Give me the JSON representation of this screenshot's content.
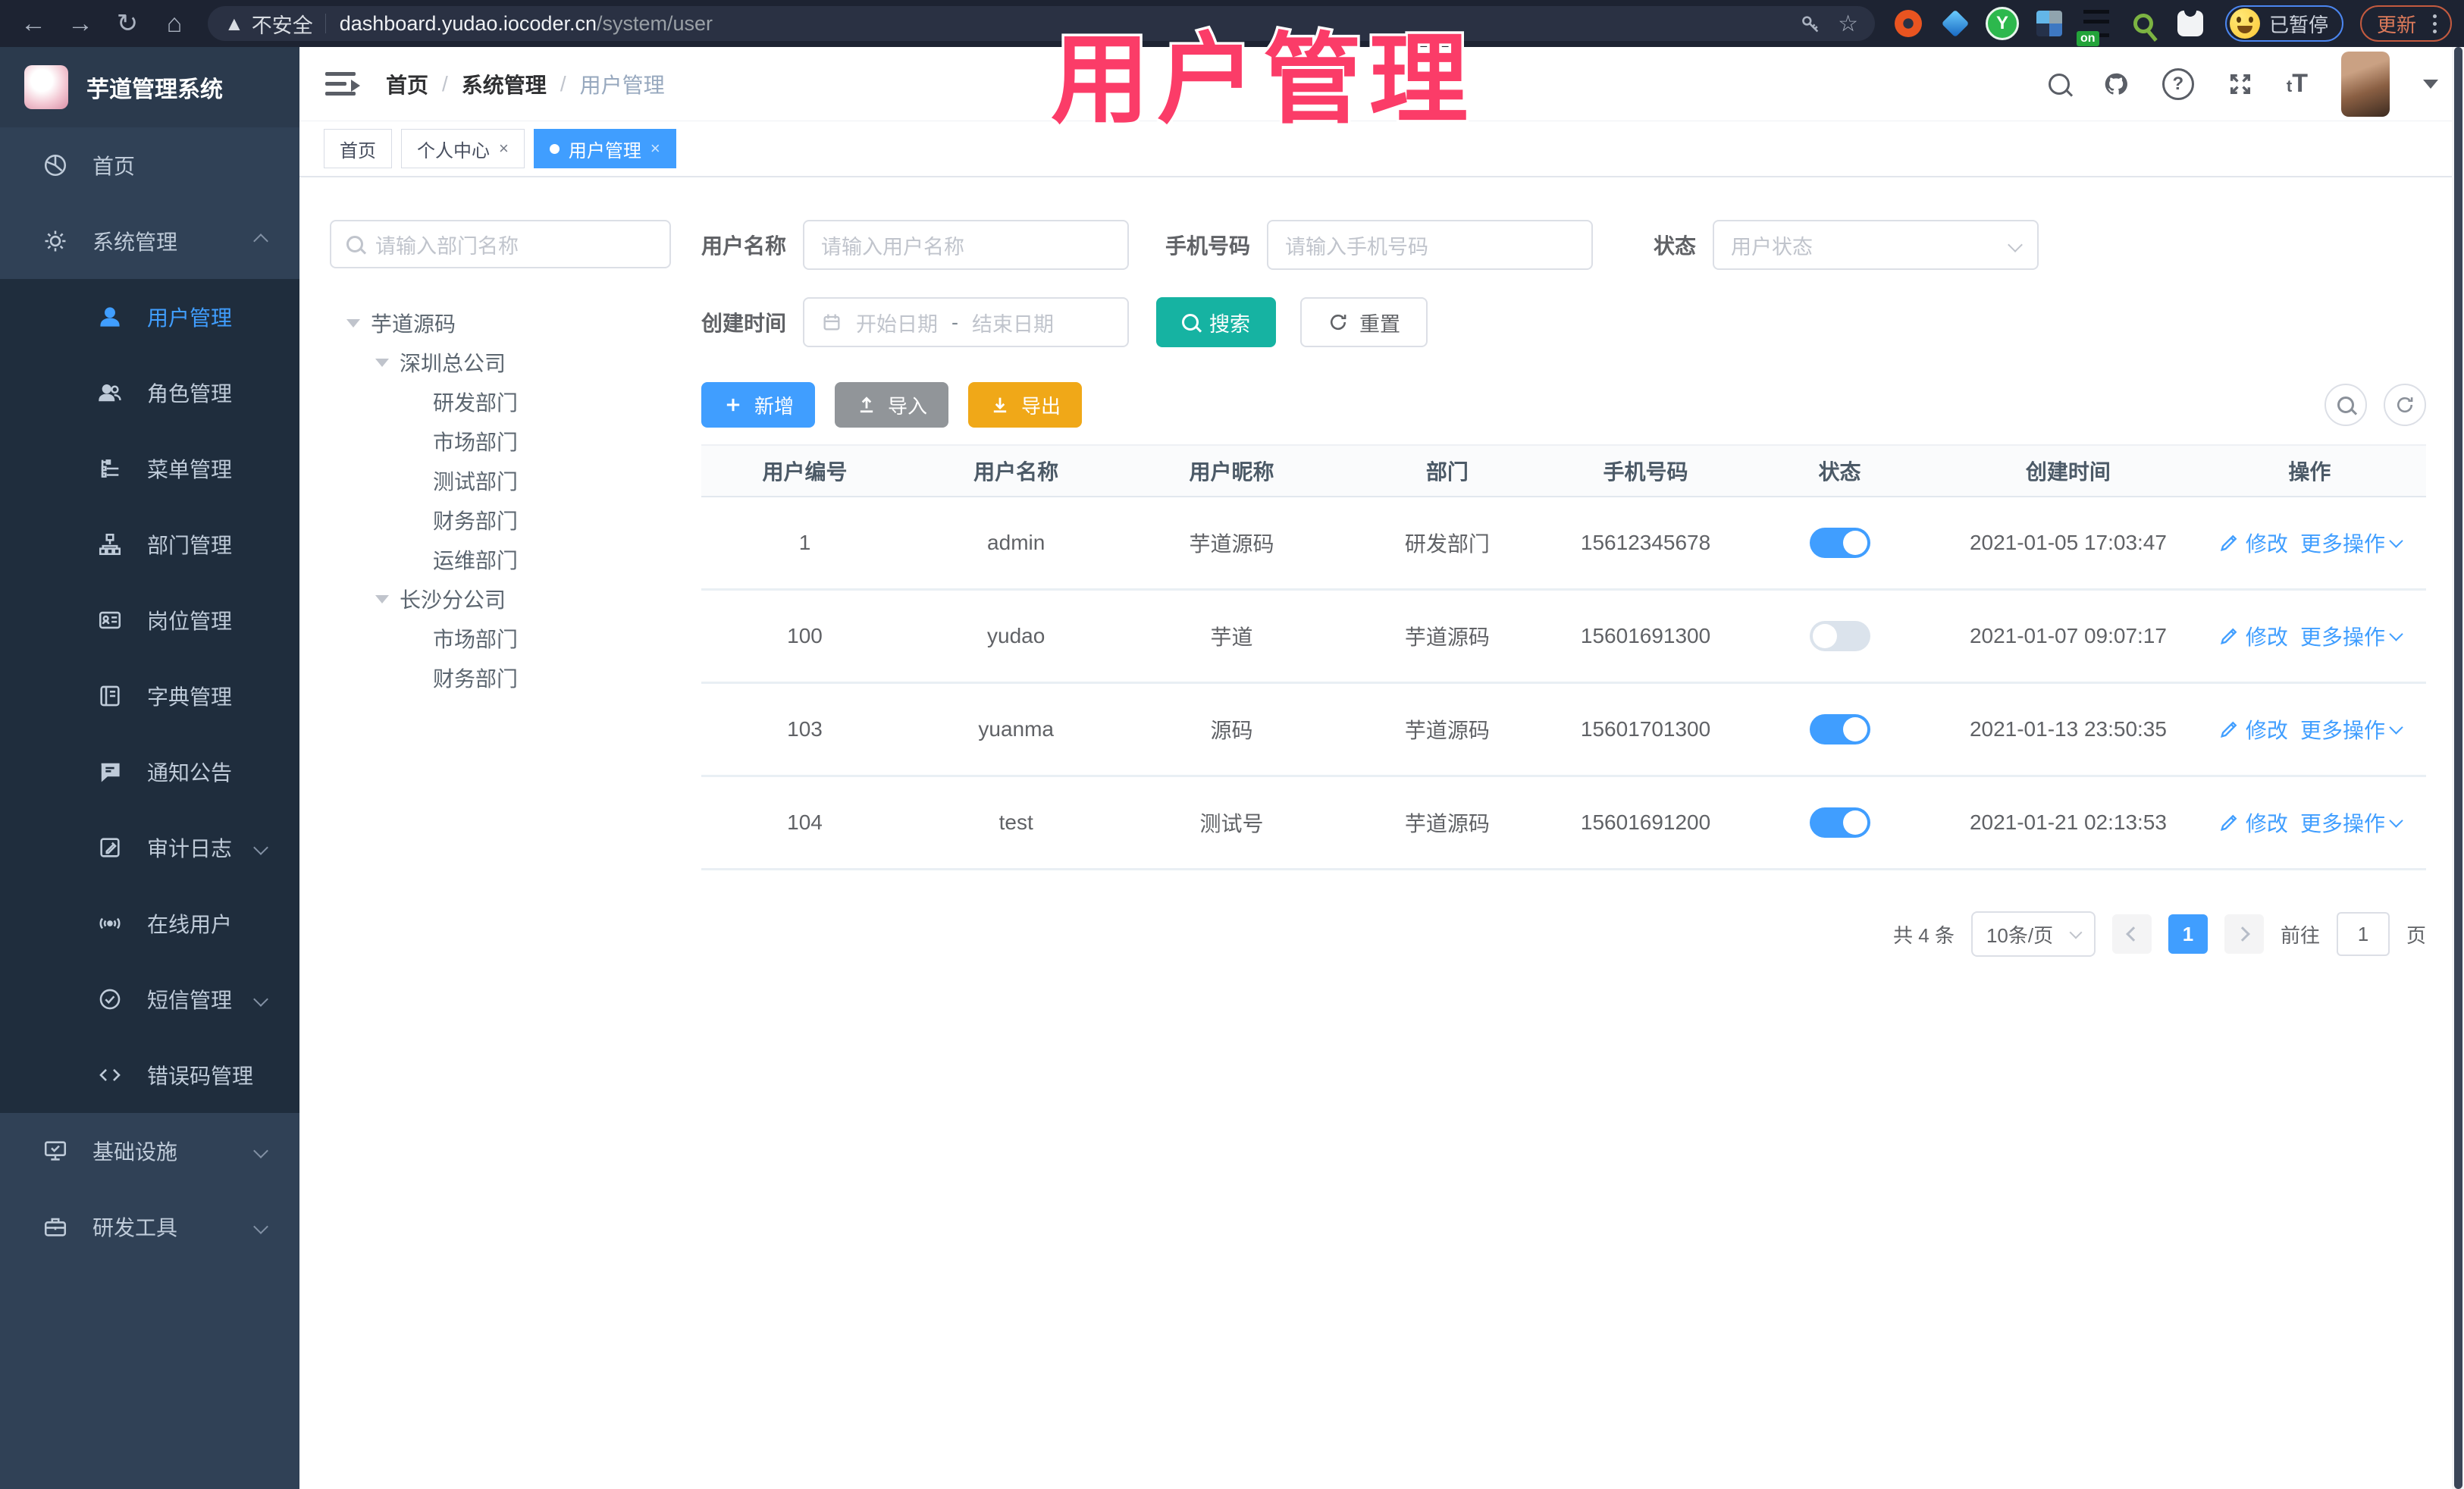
{
  "colors": {
    "accent": "#409eff",
    "search_teal": "#16b3a2",
    "export_amber": "#f0a818",
    "sidebar_bg": "#304156",
    "submenu_bg": "#1f2d3d",
    "overlay_pink": "#fb3c68"
  },
  "overlay": {
    "title": "用户管理"
  },
  "browser": {
    "security_label": "不安全",
    "url_host": "dashboard.yudao.iocoder.cn",
    "url_path": "/system/user",
    "ext_on_badge": "on",
    "ext_y_letter": "Y",
    "profile_status": "已暂停",
    "update_label": "更新"
  },
  "sidebar": {
    "logo_title": "芋道管理系统",
    "items": [
      {
        "key": "home",
        "label": "首页",
        "icon": "dashboard-icon",
        "level": 0
      },
      {
        "key": "system-management",
        "label": "系统管理",
        "icon": "gear-icon",
        "level": 0,
        "arrow": "up"
      },
      {
        "key": "user-management",
        "label": "用户管理",
        "icon": "user-icon",
        "level": 1,
        "active": true
      },
      {
        "key": "role-management",
        "label": "角色管理",
        "icon": "users-icon",
        "level": 1
      },
      {
        "key": "menu-management",
        "label": "菜单管理",
        "icon": "menu-tree-icon",
        "level": 1
      },
      {
        "key": "dept-management",
        "label": "部门管理",
        "icon": "org-tree-icon",
        "level": 1
      },
      {
        "key": "post-management",
        "label": "岗位管理",
        "icon": "badge-icon",
        "level": 1
      },
      {
        "key": "dict-management",
        "label": "字典管理",
        "icon": "book-icon",
        "level": 1
      },
      {
        "key": "notice",
        "label": "通知公告",
        "icon": "message-icon",
        "level": 1
      },
      {
        "key": "audit-log",
        "label": "审计日志",
        "icon": "log-icon",
        "level": 1,
        "arrow": "down"
      },
      {
        "key": "online-users",
        "label": "在线用户",
        "icon": "online-icon",
        "level": 1
      },
      {
        "key": "sms-management",
        "label": "短信管理",
        "icon": "sms-icon",
        "level": 1,
        "arrow": "down"
      },
      {
        "key": "error-code-management",
        "label": "错误码管理",
        "icon": "code-icon",
        "level": 1
      },
      {
        "key": "infrastructure",
        "label": "基础设施",
        "icon": "infra-icon",
        "level": 0,
        "arrow": "down"
      },
      {
        "key": "dev-tools",
        "label": "研发工具",
        "icon": "tools-icon",
        "level": 0,
        "arrow": "down"
      }
    ]
  },
  "header": {
    "breadcrumb": [
      "首页",
      "系统管理",
      "用户管理"
    ]
  },
  "tabs": [
    {
      "key": "home",
      "label": "首页"
    },
    {
      "key": "profile",
      "label": "个人中心",
      "closable": true
    },
    {
      "key": "user-management",
      "label": "用户管理",
      "closable": true,
      "active": true
    }
  ],
  "tree": {
    "search_placeholder": "请输入部门名称",
    "nodes": [
      {
        "label": "芋道源码",
        "level": 0,
        "expanded": true
      },
      {
        "label": "深圳总公司",
        "level": 1,
        "expanded": true
      },
      {
        "label": "研发部门",
        "level": 2
      },
      {
        "label": "市场部门",
        "level": 2
      },
      {
        "label": "测试部门",
        "level": 2
      },
      {
        "label": "财务部门",
        "level": 2
      },
      {
        "label": "运维部门",
        "level": 2
      },
      {
        "label": "长沙分公司",
        "level": 1,
        "expanded": true
      },
      {
        "label": "市场部门",
        "level": 2
      },
      {
        "label": "财务部门",
        "level": 2
      }
    ]
  },
  "filters": {
    "username_label": "用户名称",
    "username_placeholder": "请输入用户名称",
    "mobile_label": "手机号码",
    "mobile_placeholder": "请输入手机号码",
    "status_label": "状态",
    "status_placeholder": "用户状态",
    "created_label": "创建时间",
    "date_start_placeholder": "开始日期",
    "date_separator": "-",
    "date_end_placeholder": "结束日期",
    "search_label": "搜索",
    "reset_label": "重置"
  },
  "toolbar": {
    "add_label": "新增",
    "import_label": "导入",
    "export_label": "导出"
  },
  "table": {
    "columns": [
      "用户编号",
      "用户名称",
      "用户昵称",
      "部门",
      "手机号码",
      "状态",
      "创建时间",
      "操作"
    ],
    "action_edit": "修改",
    "action_more": "更多操作",
    "rows": [
      {
        "id": "1",
        "username": "admin",
        "nickname": "芋道源码",
        "dept": "研发部门",
        "mobile": "15612345678",
        "status": true,
        "created": "2021-01-05 17:03:47"
      },
      {
        "id": "100",
        "username": "yudao",
        "nickname": "芋道",
        "dept": "芋道源码",
        "mobile": "15601691300",
        "status": false,
        "created": "2021-01-07 09:07:17"
      },
      {
        "id": "103",
        "username": "yuanma",
        "nickname": "源码",
        "dept": "芋道源码",
        "mobile": "15601701300",
        "status": true,
        "created": "2021-01-13 23:50:35"
      },
      {
        "id": "104",
        "username": "test",
        "nickname": "测试号",
        "dept": "芋道源码",
        "mobile": "15601691200",
        "status": true,
        "created": "2021-01-21 02:13:53"
      }
    ]
  },
  "pagination": {
    "total": "共 4 条",
    "page_size": "10条/页",
    "current_page": "1",
    "goto_label": "前往",
    "goto_value": "1",
    "page_unit": "页"
  }
}
